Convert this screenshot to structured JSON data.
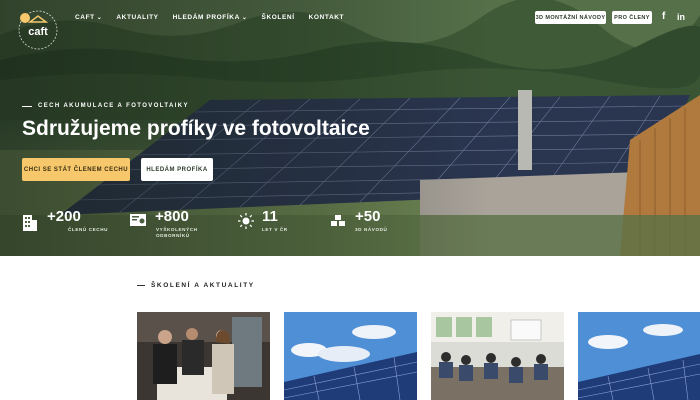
{
  "brand": {
    "logo_text": "caft",
    "logo_ring_text": "CECH AKUMULACE A FOTOVOLTAIKY"
  },
  "nav": {
    "items": [
      {
        "label": "CAFT",
        "has_dropdown": true
      },
      {
        "label": "AKTUALITY",
        "has_dropdown": false
      },
      {
        "label": "HLEDÁM PROFÍKA",
        "has_dropdown": true
      },
      {
        "label": "ŠKOLENÍ",
        "has_dropdown": false
      },
      {
        "label": "KONTAKT",
        "has_dropdown": false
      }
    ],
    "chevron": "⌄"
  },
  "header_actions": {
    "montazni": "3D MONTÁŽNÍ NÁVODY",
    "clenove": "PRO ČLENY",
    "facebook": "f",
    "linkedin": "in"
  },
  "hero": {
    "kicker": "CECH AKUMULACE A FOTOVOLTAIKY",
    "title": "Sdružujeme profíky ve fotovoltaice",
    "cta_primary": "CHCI SE STÁT ČLENEM CECHU",
    "cta_secondary": "HLEDÁM PROFÍKA",
    "stats": [
      {
        "number": "+200",
        "label_line1": "ČLENŮ CECHU",
        "label_line2": "",
        "icon": "building-icon"
      },
      {
        "number": "+800",
        "label_line1": "VYŠKOLENÝCH",
        "label_line2": "ODBORNÍKŮ",
        "icon": "certificate-icon"
      },
      {
        "number": "11",
        "label_line1": "LET V ČR",
        "label_line2": "",
        "icon": "sun-icon"
      },
      {
        "number": "+50",
        "label_line1": "3D NÁVODŮ",
        "label_line2": "",
        "icon": "cubes-icon"
      }
    ]
  },
  "news": {
    "kicker": "ŠKOLENÍ A AKTUALITY",
    "cards": [
      {
        "image": "training-photo"
      },
      {
        "image": "solar-panels-sky"
      },
      {
        "image": "classroom-photo"
      },
      {
        "image": "solar-panels-sky"
      }
    ]
  },
  "colors": {
    "accent": "#f6c86b",
    "text_dark": "#222222",
    "white": "#ffffff"
  }
}
